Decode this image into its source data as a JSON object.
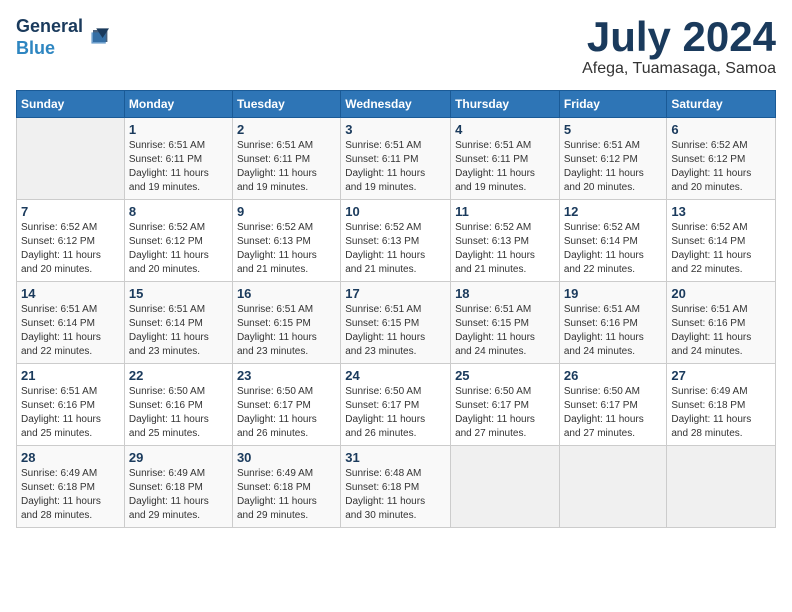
{
  "header": {
    "logo_line1": "General",
    "logo_line2": "Blue",
    "month_year": "July 2024",
    "location": "Afega, Tuamasaga, Samoa"
  },
  "days_of_week": [
    "Sunday",
    "Monday",
    "Tuesday",
    "Wednesday",
    "Thursday",
    "Friday",
    "Saturday"
  ],
  "weeks": [
    [
      {
        "day": "",
        "info": ""
      },
      {
        "day": "1",
        "info": "Sunrise: 6:51 AM\nSunset: 6:11 PM\nDaylight: 11 hours\nand 19 minutes."
      },
      {
        "day": "2",
        "info": "Sunrise: 6:51 AM\nSunset: 6:11 PM\nDaylight: 11 hours\nand 19 minutes."
      },
      {
        "day": "3",
        "info": "Sunrise: 6:51 AM\nSunset: 6:11 PM\nDaylight: 11 hours\nand 19 minutes."
      },
      {
        "day": "4",
        "info": "Sunrise: 6:51 AM\nSunset: 6:11 PM\nDaylight: 11 hours\nand 19 minutes."
      },
      {
        "day": "5",
        "info": "Sunrise: 6:51 AM\nSunset: 6:12 PM\nDaylight: 11 hours\nand 20 minutes."
      },
      {
        "day": "6",
        "info": "Sunrise: 6:52 AM\nSunset: 6:12 PM\nDaylight: 11 hours\nand 20 minutes."
      }
    ],
    [
      {
        "day": "7",
        "info": "Sunrise: 6:52 AM\nSunset: 6:12 PM\nDaylight: 11 hours\nand 20 minutes."
      },
      {
        "day": "8",
        "info": "Sunrise: 6:52 AM\nSunset: 6:12 PM\nDaylight: 11 hours\nand 20 minutes."
      },
      {
        "day": "9",
        "info": "Sunrise: 6:52 AM\nSunset: 6:13 PM\nDaylight: 11 hours\nand 21 minutes."
      },
      {
        "day": "10",
        "info": "Sunrise: 6:52 AM\nSunset: 6:13 PM\nDaylight: 11 hours\nand 21 minutes."
      },
      {
        "day": "11",
        "info": "Sunrise: 6:52 AM\nSunset: 6:13 PM\nDaylight: 11 hours\nand 21 minutes."
      },
      {
        "day": "12",
        "info": "Sunrise: 6:52 AM\nSunset: 6:14 PM\nDaylight: 11 hours\nand 22 minutes."
      },
      {
        "day": "13",
        "info": "Sunrise: 6:52 AM\nSunset: 6:14 PM\nDaylight: 11 hours\nand 22 minutes."
      }
    ],
    [
      {
        "day": "14",
        "info": "Sunrise: 6:51 AM\nSunset: 6:14 PM\nDaylight: 11 hours\nand 22 minutes."
      },
      {
        "day": "15",
        "info": "Sunrise: 6:51 AM\nSunset: 6:14 PM\nDaylight: 11 hours\nand 23 minutes."
      },
      {
        "day": "16",
        "info": "Sunrise: 6:51 AM\nSunset: 6:15 PM\nDaylight: 11 hours\nand 23 minutes."
      },
      {
        "day": "17",
        "info": "Sunrise: 6:51 AM\nSunset: 6:15 PM\nDaylight: 11 hours\nand 23 minutes."
      },
      {
        "day": "18",
        "info": "Sunrise: 6:51 AM\nSunset: 6:15 PM\nDaylight: 11 hours\nand 24 minutes."
      },
      {
        "day": "19",
        "info": "Sunrise: 6:51 AM\nSunset: 6:16 PM\nDaylight: 11 hours\nand 24 minutes."
      },
      {
        "day": "20",
        "info": "Sunrise: 6:51 AM\nSunset: 6:16 PM\nDaylight: 11 hours\nand 24 minutes."
      }
    ],
    [
      {
        "day": "21",
        "info": "Sunrise: 6:51 AM\nSunset: 6:16 PM\nDaylight: 11 hours\nand 25 minutes."
      },
      {
        "day": "22",
        "info": "Sunrise: 6:50 AM\nSunset: 6:16 PM\nDaylight: 11 hours\nand 25 minutes."
      },
      {
        "day": "23",
        "info": "Sunrise: 6:50 AM\nSunset: 6:17 PM\nDaylight: 11 hours\nand 26 minutes."
      },
      {
        "day": "24",
        "info": "Sunrise: 6:50 AM\nSunset: 6:17 PM\nDaylight: 11 hours\nand 26 minutes."
      },
      {
        "day": "25",
        "info": "Sunrise: 6:50 AM\nSunset: 6:17 PM\nDaylight: 11 hours\nand 27 minutes."
      },
      {
        "day": "26",
        "info": "Sunrise: 6:50 AM\nSunset: 6:17 PM\nDaylight: 11 hours\nand 27 minutes."
      },
      {
        "day": "27",
        "info": "Sunrise: 6:49 AM\nSunset: 6:18 PM\nDaylight: 11 hours\nand 28 minutes."
      }
    ],
    [
      {
        "day": "28",
        "info": "Sunrise: 6:49 AM\nSunset: 6:18 PM\nDaylight: 11 hours\nand 28 minutes."
      },
      {
        "day": "29",
        "info": "Sunrise: 6:49 AM\nSunset: 6:18 PM\nDaylight: 11 hours\nand 29 minutes."
      },
      {
        "day": "30",
        "info": "Sunrise: 6:49 AM\nSunset: 6:18 PM\nDaylight: 11 hours\nand 29 minutes."
      },
      {
        "day": "31",
        "info": "Sunrise: 6:48 AM\nSunset: 6:18 PM\nDaylight: 11 hours\nand 30 minutes."
      },
      {
        "day": "",
        "info": ""
      },
      {
        "day": "",
        "info": ""
      },
      {
        "day": "",
        "info": ""
      }
    ]
  ]
}
